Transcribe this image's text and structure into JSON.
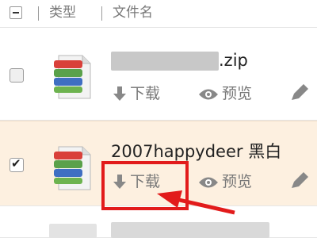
{
  "header": {
    "col_type": "类型",
    "col_filename": "文件名"
  },
  "files": [
    {
      "name_suffix": ".zip",
      "checked": false,
      "actions": {
        "download": "下载",
        "preview": "预览"
      }
    },
    {
      "name": "2007happydeer 黑白",
      "checked": true,
      "actions": {
        "download": "下载",
        "preview": "预览"
      }
    }
  ],
  "colors": {
    "highlight": "#e21b1b",
    "selected_row": "#fdf0e0"
  }
}
